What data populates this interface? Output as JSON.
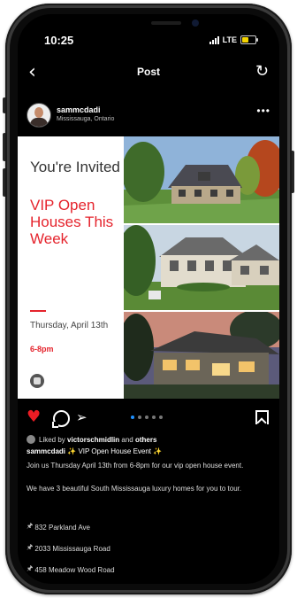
{
  "status": {
    "time": "10:25",
    "network": "LTE"
  },
  "nav": {
    "title": "Post"
  },
  "author": {
    "username": "sammcdadi",
    "location": "Mississauga, Ontario"
  },
  "flyer": {
    "line1": "You're Invited",
    "line2": "VIP Open Houses This Week",
    "date": "Thursday, April 13th",
    "time": "6-8pm"
  },
  "carousel": {
    "count": 5,
    "active": 0
  },
  "likes": {
    "prefix": "Liked by ",
    "user": "victorschmidlin",
    "mid": " and ",
    "others": "others"
  },
  "caption": {
    "user": "sammcdadi",
    "text": " VIP Open House Event "
  },
  "body": {
    "p1": "Join us Thursday April 13th from 6-8pm for our vip open house event.",
    "p2": "We have 3 beautiful South Mississauga luxury homes for you to tour.",
    "addresses": [
      "832 Parkland Ave",
      "2033 Mississauga Road",
      "458 Meadow Wood Road"
    ]
  },
  "colors": {
    "accent": "#e5242d",
    "like": "#ed1c24",
    "active_dot": "#1e90ff"
  },
  "icons": [
    "back-arrow-icon",
    "refresh-icon",
    "more-icon",
    "heart-icon",
    "comment-icon",
    "share-icon",
    "bookmark-icon",
    "pin-icon"
  ]
}
